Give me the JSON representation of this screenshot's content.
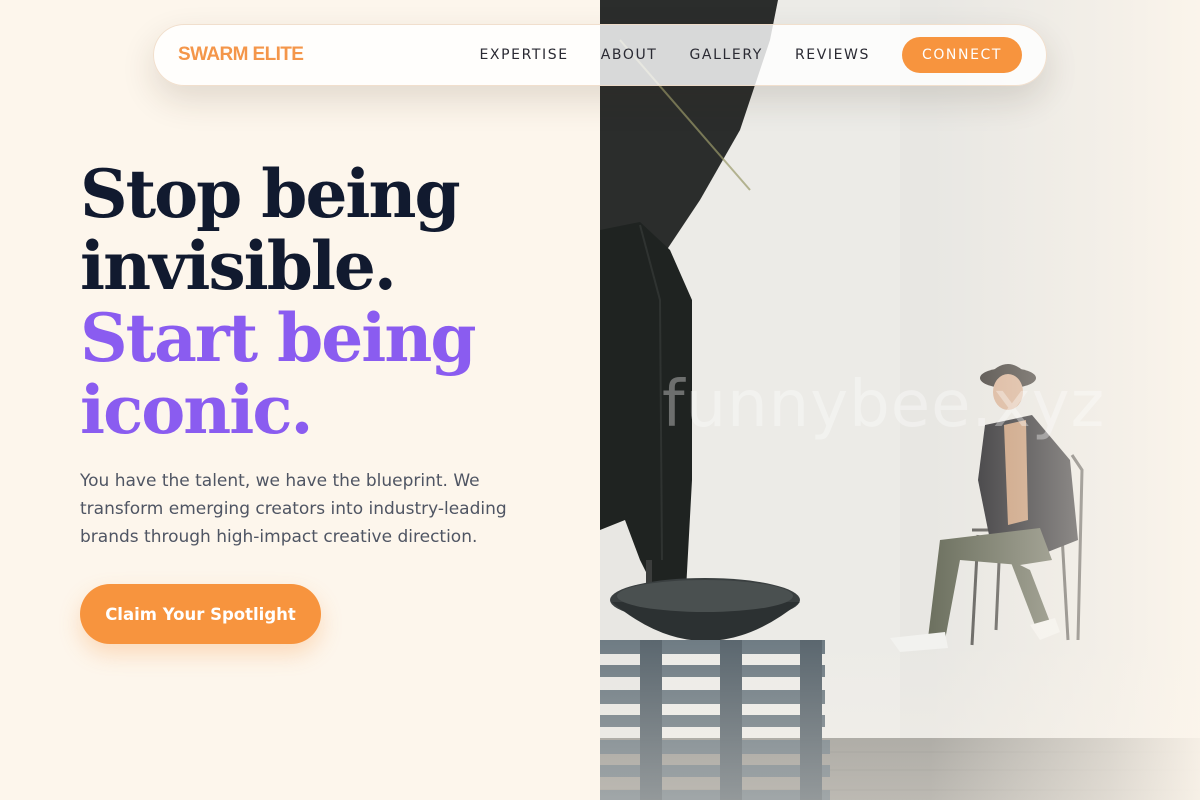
{
  "nav": {
    "brand": "SWARM ELITE",
    "links": [
      "EXPERTISE",
      "ABOUT",
      "GALLERY",
      "REVIEWS"
    ],
    "cta": "CONNECT"
  },
  "hero": {
    "title_line_1": "Stop being",
    "title_line_2": "invisible.",
    "accent_line_1": "Start being",
    "accent_line_2": "iconic.",
    "description": "You have the talent, we have the blueprint. We transform emerging creators into industry-leading brands through high-impact creative direction.",
    "cta_label": "Claim Your Spotlight"
  },
  "photo": {
    "watermark": "funnybee.xyz"
  },
  "colors": {
    "background": "#fdf6ec",
    "brand_orange": "#f7943e",
    "accent_purple": "#8a5cf0",
    "heading_dark": "#111a2f",
    "body_text": "#4f5563"
  }
}
